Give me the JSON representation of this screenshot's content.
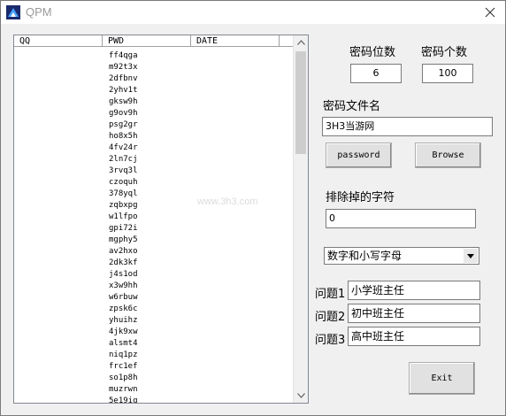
{
  "window": {
    "title": "QPM"
  },
  "list": {
    "columns": [
      "QQ",
      "PWD",
      "DATE"
    ],
    "rows": [
      "ff4qga",
      "m92t3x",
      "2dfbnv",
      "2yhv1t",
      "gksw9h",
      "g9ov9h",
      "psg2gr",
      "ho8x5h",
      "4fv24r",
      "2ln7cj",
      "3rvq3l",
      "czoquh",
      "378yql",
      "zqbxpg",
      "w1lfpo",
      "gpi72i",
      "mgphy5",
      "av2hxo",
      "2dk3kf",
      "j4s1od",
      "x3w9hh",
      "w6rbuw",
      "zpsk6c",
      "yhuihz",
      "4jk9xw",
      "alsmt4",
      "niq1pz",
      "frc1ef",
      "so1p8h",
      "muzrwn",
      "5e19iq"
    ]
  },
  "form": {
    "length_label": "密码位数",
    "length_value": "6",
    "count_label": "密码个数",
    "count_value": "100",
    "filename_label": "密码文件名",
    "filename_value": "3H3当游网",
    "password_button": "password",
    "browse_button": "Browse",
    "exclude_label": "排除掉的字符",
    "exclude_value": "0",
    "charset_selected": "数字和小写字母",
    "q1_label": "问题1",
    "q1_value": "小学班主任",
    "q2_label": "问题2",
    "q2_value": "初中班主任",
    "q3_label": "问题3",
    "q3_value": "高中班主任",
    "exit_button": "Exit"
  },
  "watermark": "www.3h3.com"
}
